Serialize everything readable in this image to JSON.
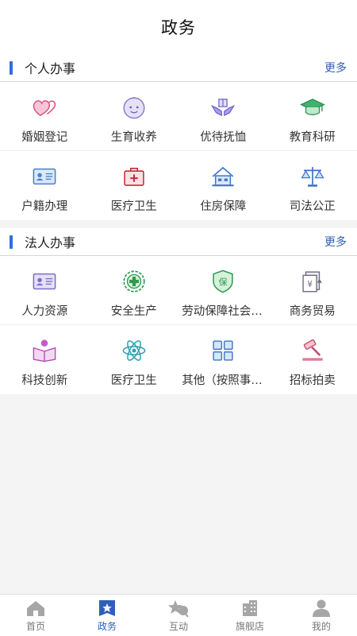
{
  "header": {
    "title": "政务"
  },
  "personal": {
    "title": "个人办事",
    "more": "更多",
    "items": [
      {
        "label": "婚姻登记",
        "icon": "hearts-icon"
      },
      {
        "label": "生育收养",
        "icon": "baby-face-icon"
      },
      {
        "label": "优待抚恤",
        "icon": "hands-gift-icon"
      },
      {
        "label": "教育科研",
        "icon": "graduation-cap-icon"
      },
      {
        "label": "户籍办理",
        "icon": "id-card-icon"
      },
      {
        "label": "医疗卫生",
        "icon": "medical-kit-icon"
      },
      {
        "label": "住房保障",
        "icon": "house-icon"
      },
      {
        "label": "司法公正",
        "icon": "scales-icon"
      }
    ]
  },
  "legal": {
    "title": "法人办事",
    "more": "更多",
    "items": [
      {
        "label": "人力资源",
        "icon": "id-card-icon"
      },
      {
        "label": "安全生产",
        "icon": "safety-cross-icon"
      },
      {
        "label": "劳动保障社会保险",
        "icon": "shield-bao-icon"
      },
      {
        "label": "商务贸易",
        "icon": "document-yen-icon"
      },
      {
        "label": "科技创新",
        "icon": "reading-person-icon"
      },
      {
        "label": "医疗卫生",
        "icon": "atom-icon"
      },
      {
        "label": "其他（按照事项分类）",
        "icon": "grid-icon"
      },
      {
        "label": "招标拍卖",
        "icon": "auction-hammer-icon"
      }
    ]
  },
  "tabbar": {
    "items": [
      {
        "label": "首页",
        "icon": "home-icon"
      },
      {
        "label": "政务",
        "icon": "star-badge-icon",
        "active": true
      },
      {
        "label": "互动",
        "icon": "star-chat-icon"
      },
      {
        "label": "旗舰店",
        "icon": "building-icon"
      },
      {
        "label": "我的",
        "icon": "person-icon"
      }
    ]
  },
  "colors": {
    "accent": "#2f5fb8",
    "bar": "#2f6fd8",
    "tab_inactive": "#a6a6a6"
  }
}
